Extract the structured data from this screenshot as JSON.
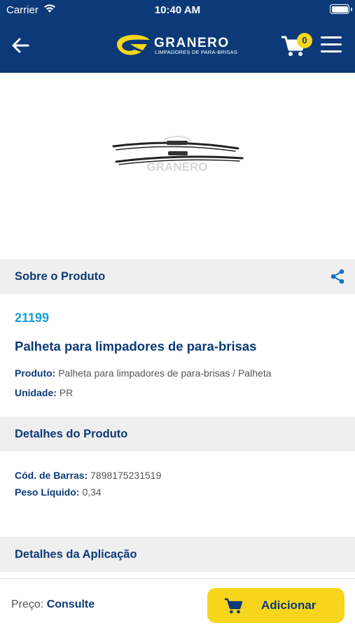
{
  "status_bar": {
    "carrier": "Carrier",
    "time": "10:40 AM",
    "wifi_icon": "wifi-icon",
    "battery_icon": "battery-icon"
  },
  "header": {
    "back_icon": "back-arrow-icon",
    "logo": {
      "name": "GRANERO",
      "tagline": "LIMPADORES DE PARA-BRISAS"
    },
    "cart_icon": "cart-icon",
    "cart_count": "0",
    "menu_icon": "menu-icon",
    "background": "#0c3a78",
    "accent": "#f7d51a"
  },
  "product_image": {
    "description_icon": "wiper-blades-image",
    "watermark": "GRANERO"
  },
  "about": {
    "title": "Sobre o Produto",
    "share_icon": "share-icon",
    "code": "21199",
    "name": "Palheta para limpadores de para-brisas",
    "product_label": "Produto:",
    "product_value": "Palheta para limpadores de para-brisas / Palheta",
    "unit_label": "Unidade:",
    "unit_value": "PR"
  },
  "details": {
    "title": "Detalhes do Produto",
    "barcode_label": "Cód. de Barras:",
    "barcode_value": "7898175231519",
    "weight_label": "Peso Líquido:",
    "weight_value": "0,34"
  },
  "application": {
    "title": "Detalhes da Aplicação"
  },
  "footer": {
    "price_label": "Preço:",
    "price_value": "Consulte",
    "add_label": "Adicionar",
    "add_icon": "cart-icon"
  }
}
